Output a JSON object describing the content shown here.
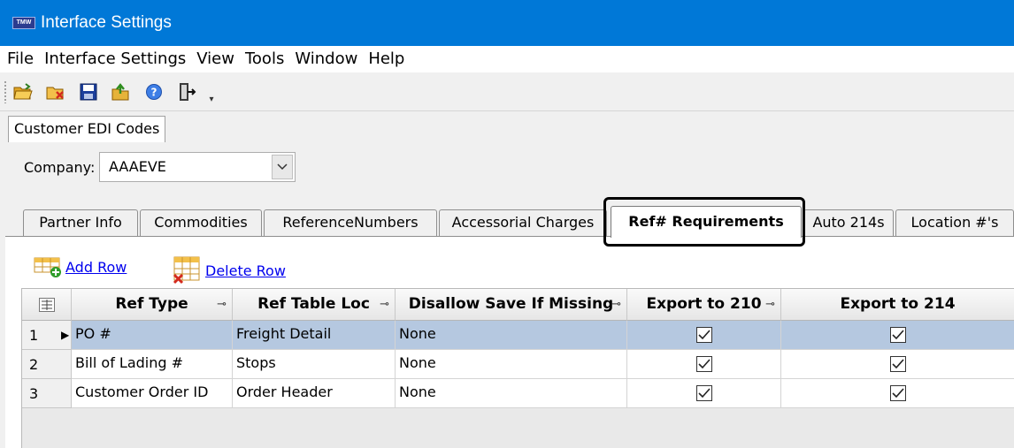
{
  "window": {
    "title": "Interface Settings",
    "app_icon_text": "TMW"
  },
  "menu": [
    "File",
    "Interface Settings",
    "View",
    "Tools",
    "Window",
    "Help"
  ],
  "toolbar": {
    "buttons": [
      "open-folder-icon",
      "close-folder-icon",
      "save-icon",
      "export-icon",
      "help-icon",
      "exit-icon"
    ],
    "overflow_icon": "▾"
  },
  "document_tab": {
    "label": "Customer EDI Codes"
  },
  "company": {
    "label": "Company:",
    "value": "AAAEVE"
  },
  "tabs": [
    {
      "label": "Partner Info"
    },
    {
      "label": "Commodities"
    },
    {
      "label": "ReferenceNumbers"
    },
    {
      "label": "Accessorial Charges"
    },
    {
      "label": "Ref# Requirements",
      "active": true
    },
    {
      "label": "Auto 214s"
    },
    {
      "label": "Location #'s"
    }
  ],
  "actions": {
    "add_row": "Add Row",
    "delete_row": "Delete Row"
  },
  "grid": {
    "columns": [
      "Ref Type",
      "Ref Table Loc",
      "Disallow Save If Missing",
      "Export to 210",
      "Export to 214"
    ],
    "pin_icon": "⊸",
    "row_pointer": "▶",
    "rows": [
      {
        "num": "1",
        "ref_type": "PO #",
        "ref_table_loc": "Freight Detail",
        "disallow": "None",
        "export210": true,
        "export214": true,
        "selected": true
      },
      {
        "num": "2",
        "ref_type": "Bill of Lading #",
        "ref_table_loc": "Stops",
        "disallow": "None",
        "export210": true,
        "export214": true
      },
      {
        "num": "3",
        "ref_type": "Customer Order ID",
        "ref_table_loc": "Order Header",
        "disallow": "None",
        "export210": true,
        "export214": true
      }
    ]
  },
  "colors": {
    "titlebar": "#0078d7",
    "selected_row": "#b5c8e0",
    "link": "#0000ee",
    "highlight_border": "#000000"
  }
}
